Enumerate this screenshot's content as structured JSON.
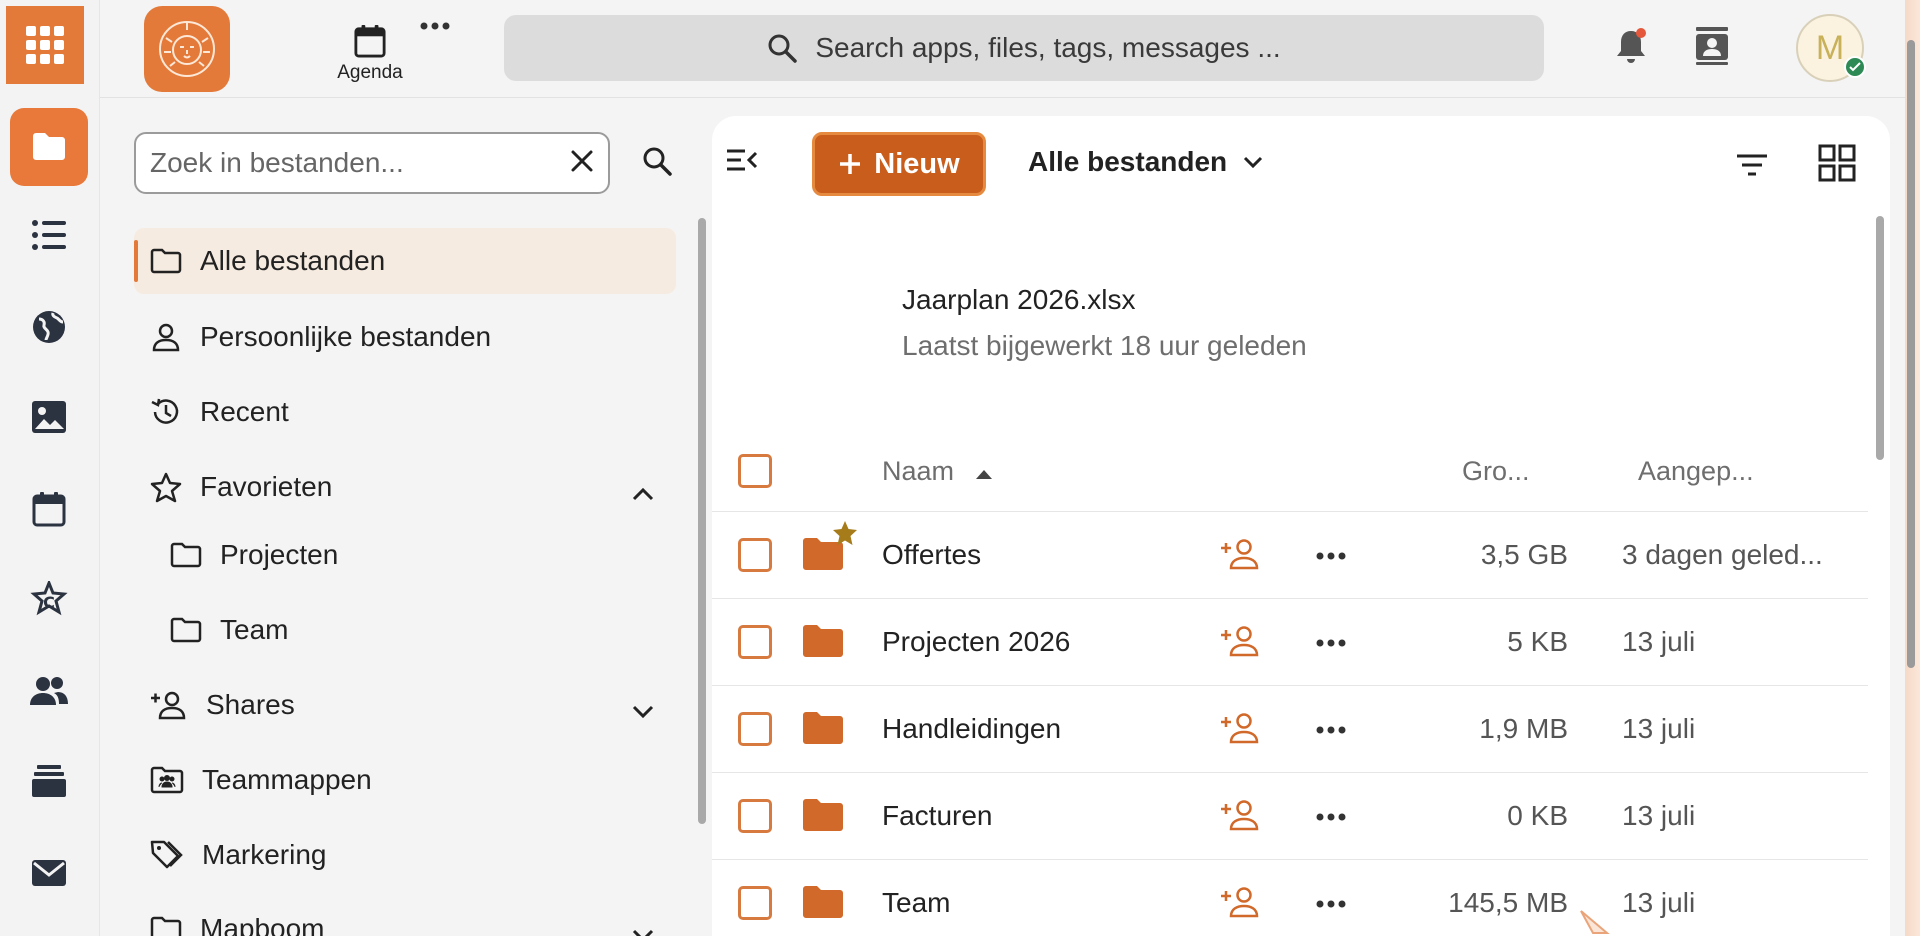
{
  "header": {
    "agenda_label": "Agenda",
    "search_placeholder": "Search apps, files, tags, messages ...",
    "avatar_initial": "M"
  },
  "nav": {
    "search_placeholder": "Zoek in bestanden...",
    "items": [
      {
        "label": "Alle bestanden",
        "icon": "folder-icon",
        "active": true
      },
      {
        "label": "Persoonlijke bestanden",
        "icon": "user-icon"
      },
      {
        "label": "Recent",
        "icon": "history-icon"
      },
      {
        "label": "Favorieten",
        "icon": "star-icon",
        "expanded": true
      },
      {
        "label": "Projecten",
        "icon": "folder-icon",
        "sub": true
      },
      {
        "label": "Team",
        "icon": "folder-icon",
        "sub": true
      },
      {
        "label": "Shares",
        "icon": "share-icon",
        "expanded": false
      },
      {
        "label": "Teammappen",
        "icon": "team-folder-icon"
      },
      {
        "label": "Markering",
        "icon": "tag-icon"
      },
      {
        "label": "Mapboom",
        "icon": "folder-icon"
      }
    ]
  },
  "toolbar": {
    "new_label": "Nieuw",
    "breadcrumb": "Alle bestanden"
  },
  "recent": {
    "file_name": "Jaarplan 2026.xlsx",
    "subtitle": "Laatst bijgewerkt 18 uur geleden"
  },
  "table": {
    "headers": {
      "name": "Naam",
      "size": "Gro...",
      "modified": "Aangep..."
    },
    "rows": [
      {
        "name": "Offertes",
        "size": "3,5 GB",
        "modified": "3 dagen geled...",
        "favorite": true
      },
      {
        "name": "Projecten 2026",
        "size": "5 KB",
        "modified": "13 juli"
      },
      {
        "name": "Handleidingen",
        "size": "1,9 MB",
        "modified": "13 juli"
      },
      {
        "name": "Facturen",
        "size": "0 KB",
        "modified": "13 juli"
      },
      {
        "name": "Team",
        "size": "145,5 MB",
        "modified": "13 juli"
      }
    ]
  },
  "colors": {
    "accent": "#e47a3a",
    "primary_button": "#c85d1c",
    "folder": "#d0692a",
    "favorite_star": "#a67c1a"
  }
}
